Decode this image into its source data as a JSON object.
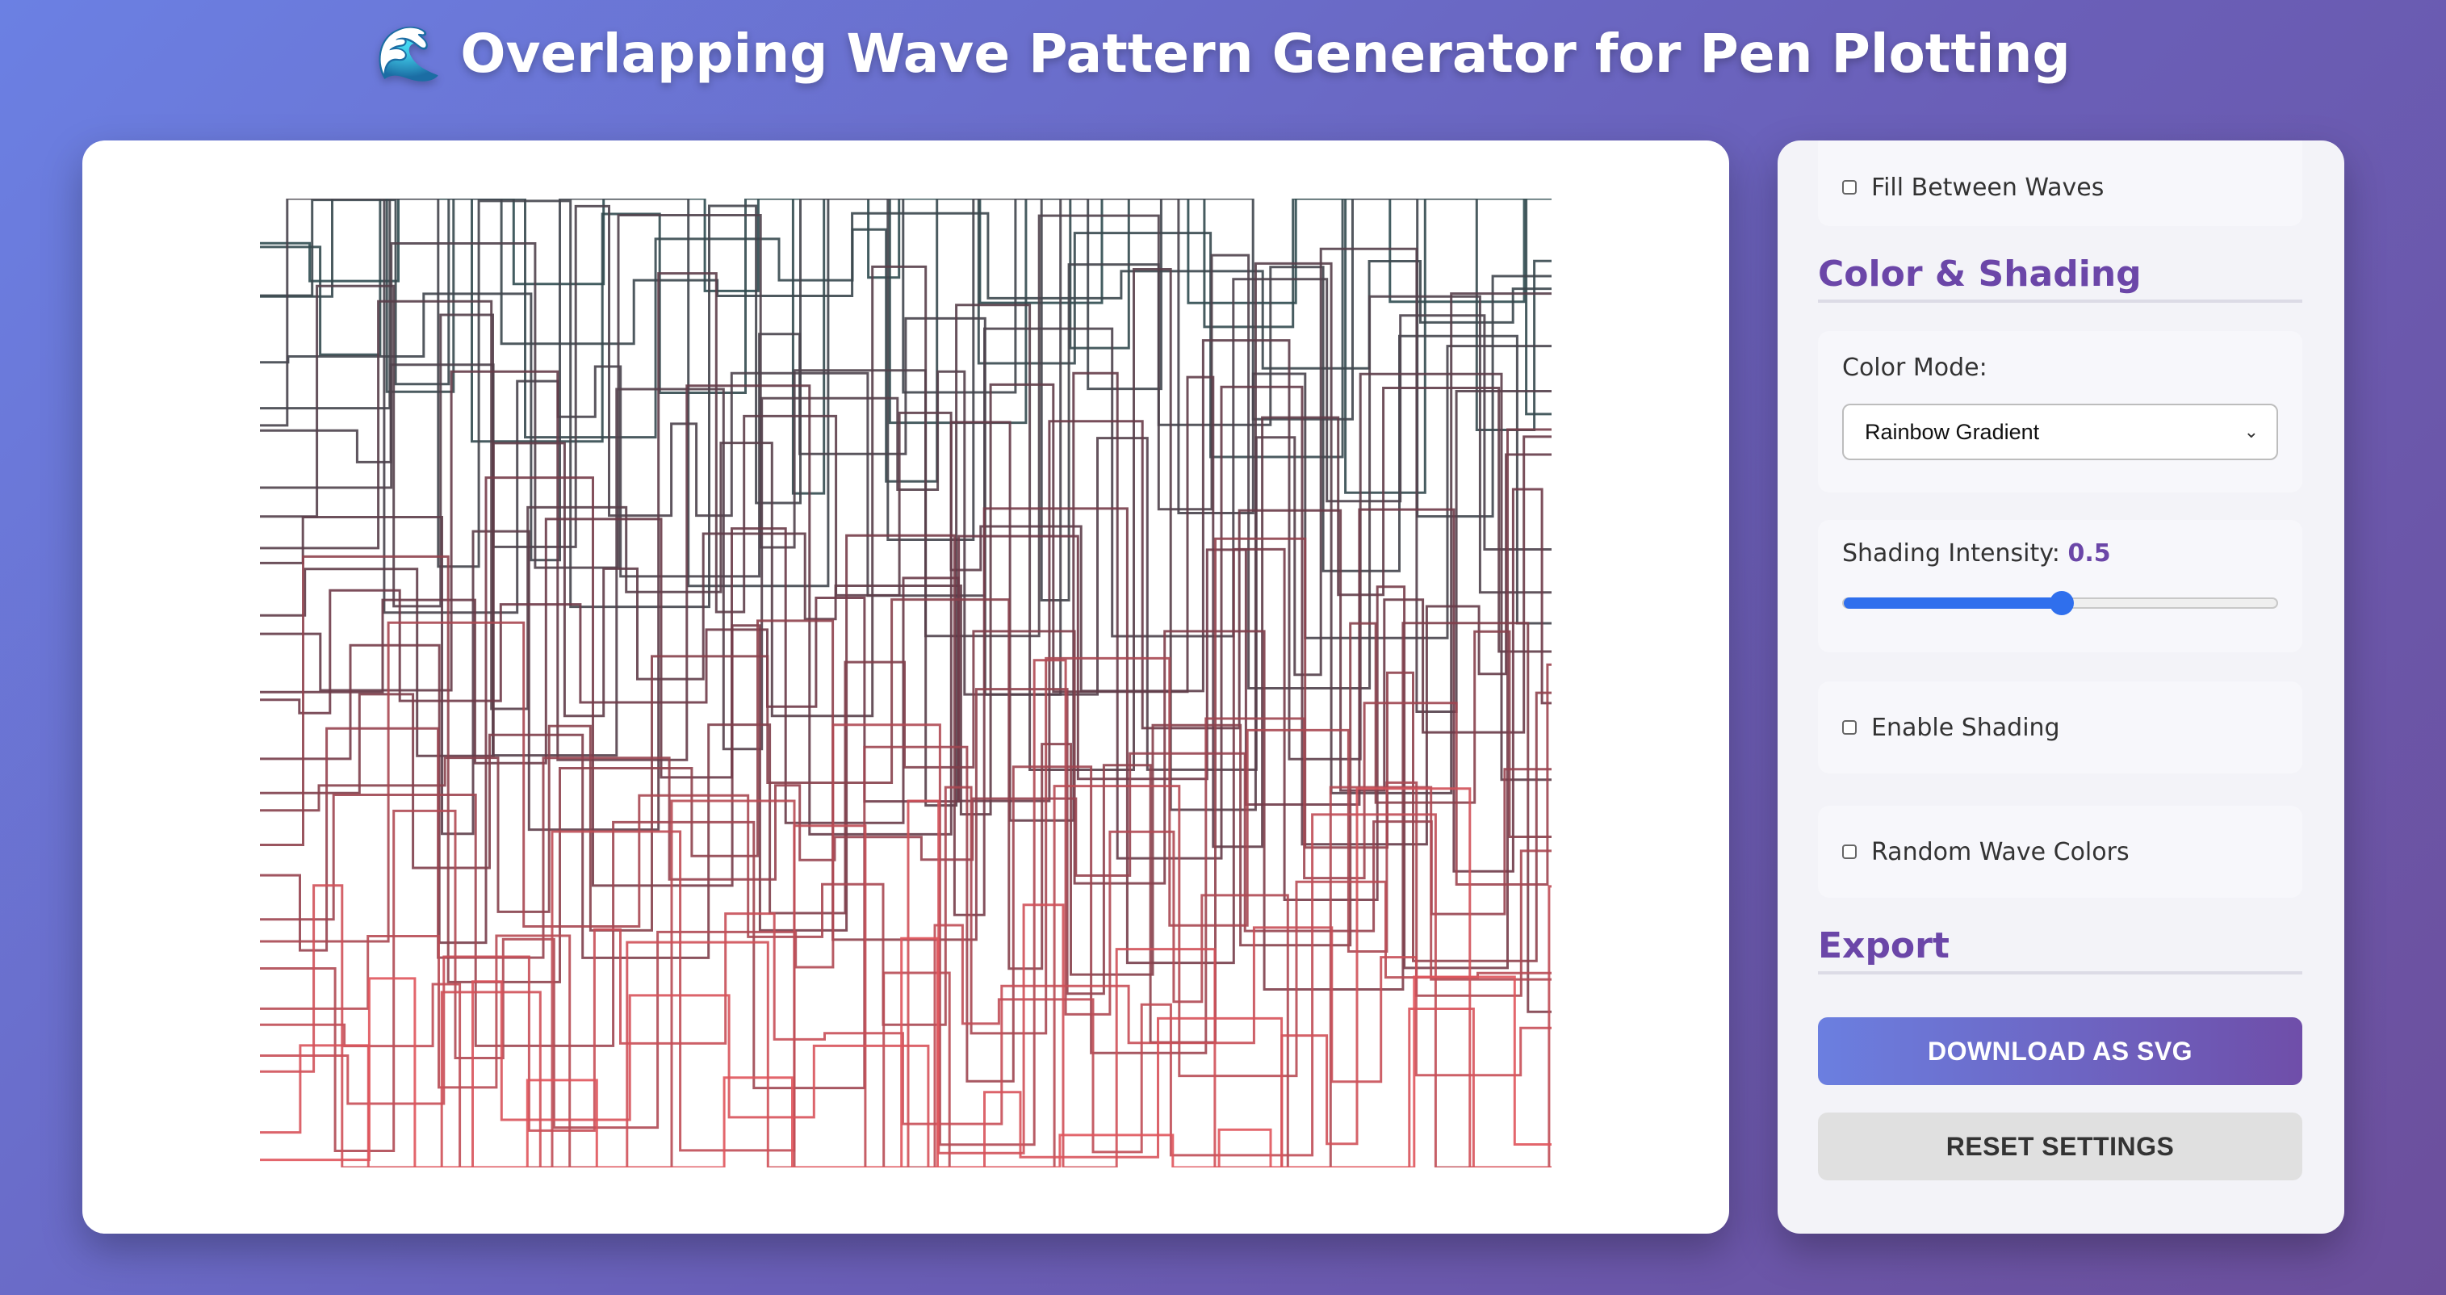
{
  "header": {
    "icon": "🌊",
    "title": "Overlapping Wave Pattern Generator for Pen Plotting"
  },
  "canvas": {
    "colors": {
      "top": "#2f4b50",
      "mid": "#6b3a48",
      "bottom": "#e0555c"
    }
  },
  "panel": {
    "fill_between": {
      "label": "Fill Between Waves",
      "checked": false
    },
    "color_section": {
      "title": "Color & Shading"
    },
    "color_mode": {
      "label": "Color Mode:",
      "value": "Rainbow Gradient"
    },
    "shading_intensity": {
      "label": "Shading Intensity:",
      "value": "0.5",
      "fraction": 0.5
    },
    "enable_shading": {
      "label": "Enable Shading",
      "checked": false
    },
    "random_colors": {
      "label": "Random Wave Colors",
      "checked": false
    },
    "export_section": {
      "title": "Export"
    },
    "download_button": {
      "label": "DOWNLOAD AS SVG"
    },
    "reset_button": {
      "label": "RESET SETTINGS"
    }
  }
}
